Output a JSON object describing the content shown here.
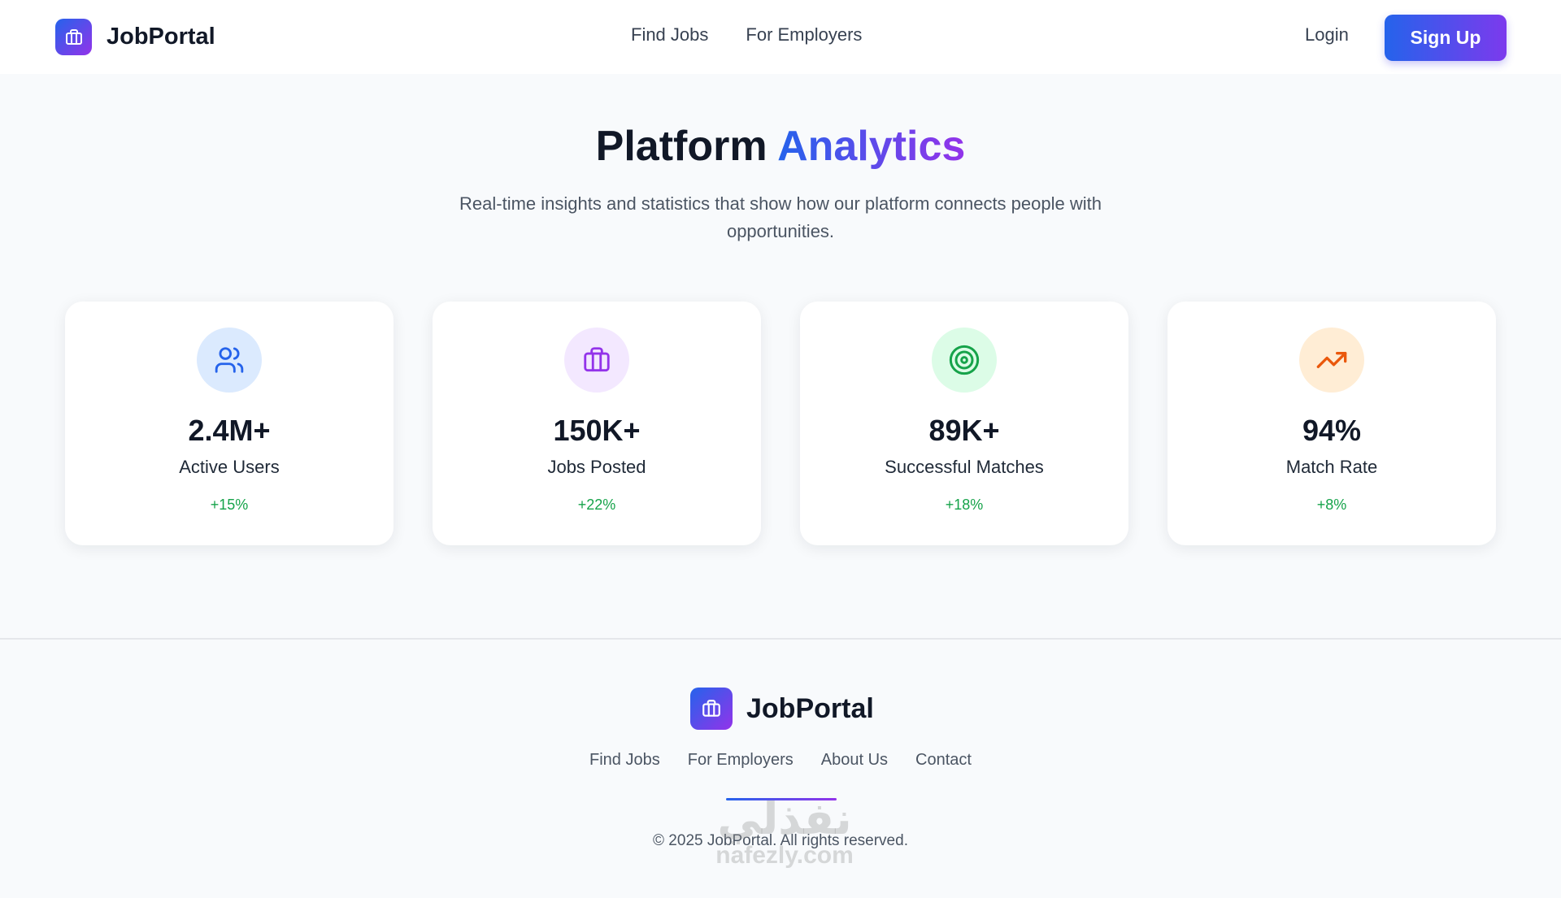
{
  "header": {
    "brand": "JobPortal",
    "nav": [
      "Find Jobs",
      "For Employers"
    ],
    "login": "Login",
    "signup": "Sign Up"
  },
  "hero": {
    "title_plain": "Platform",
    "title_gradient": "Analytics",
    "subtitle": "Real-time insights and statistics that show how our platform connects people with opportunities."
  },
  "stats": [
    {
      "icon": "users-icon",
      "value": "2.4M+",
      "label": "Active Users",
      "change": "+15%",
      "color": "#2563eb",
      "bg": "#dbeafe"
    },
    {
      "icon": "briefcase-icon",
      "value": "150K+",
      "label": "Jobs Posted",
      "change": "+22%",
      "color": "#9333ea",
      "bg": "#f3e8ff"
    },
    {
      "icon": "target-icon",
      "value": "89K+",
      "label": "Successful Matches",
      "change": "+18%",
      "color": "#16a34a",
      "bg": "#dcfce7"
    },
    {
      "icon": "trending-up-icon",
      "value": "94%",
      "label": "Match Rate",
      "change": "+8%",
      "color": "#ea580c",
      "bg": "#ffedd5"
    }
  ],
  "footer": {
    "brand": "JobPortal",
    "links": [
      "Find Jobs",
      "For Employers",
      "About Us",
      "Contact"
    ],
    "copyright": "© 2025 JobPortal. All rights reserved."
  },
  "watermark": {
    "arabic": "نفذلي",
    "latin": "nafezly.com"
  },
  "colors": {
    "accent_start": "#2563eb",
    "accent_end": "#9333ea",
    "positive": "#16a34a"
  }
}
